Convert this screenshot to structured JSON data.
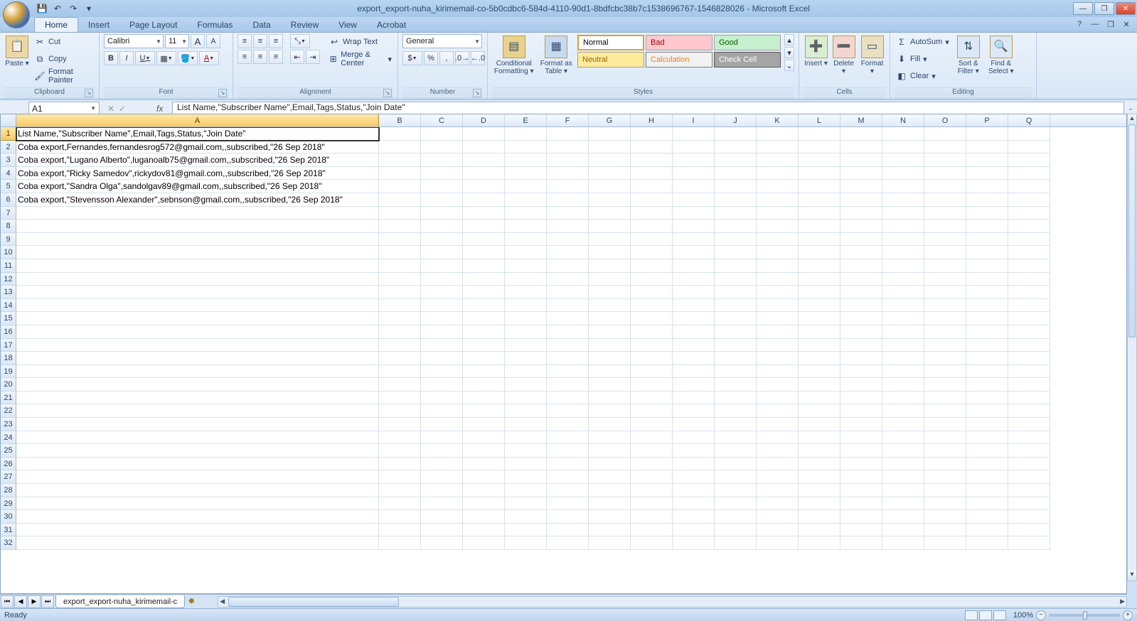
{
  "titlebar": {
    "title": "export_export-nuha_kirimemail-co-5b0cdbc6-584d-4110-90d1-8bdfcbc38b7c1538696767-1546828026 - Microsoft Excel",
    "qat": {
      "save": "💾",
      "undo": "↶",
      "redo": "↷",
      "more": "▾"
    },
    "win": {
      "min": "—",
      "max": "❐",
      "close": "✕"
    }
  },
  "tabs": {
    "items": [
      "Home",
      "Insert",
      "Page Layout",
      "Formulas",
      "Data",
      "Review",
      "View",
      "Acrobat"
    ],
    "active": "Home",
    "help": "?",
    "rmin": "—",
    "rmax": "❐",
    "rclose": "✕"
  },
  "ribbon": {
    "clipboard": {
      "label": "Clipboard",
      "paste": "Paste",
      "cut": "Cut",
      "copy": "Copy",
      "format_painter": "Format Painter"
    },
    "font": {
      "label": "Font",
      "name": "Calibri",
      "size": "11",
      "grow": "A",
      "shrink": "A",
      "bold": "B",
      "italic": "I",
      "underline": "U"
    },
    "alignment": {
      "label": "Alignment",
      "wrap": "Wrap Text",
      "merge": "Merge & Center"
    },
    "number": {
      "label": "Number",
      "format": "General"
    },
    "styles": {
      "label": "Styles",
      "cond": "Conditional Formatting",
      "table": "Format as Table",
      "normal": "Normal",
      "bad": "Bad",
      "good": "Good",
      "neutral": "Neutral",
      "calc": "Calculation",
      "check": "Check Cell"
    },
    "cells": {
      "label": "Cells",
      "insert": "Insert",
      "delete": "Delete",
      "format": "Format"
    },
    "editing": {
      "label": "Editing",
      "autosum": "AutoSum",
      "fill": "Fill",
      "clear": "Clear",
      "sort": "Sort & Filter",
      "find": "Find & Select"
    }
  },
  "formula_bar": {
    "name_box": "A1",
    "fx": "fx",
    "formula": "List Name,\"Subscriber Name\",Email,Tags,Status,\"Join Date\""
  },
  "grid": {
    "col_widths": {
      "A": 510,
      "other": 59
    },
    "columns": [
      "A",
      "B",
      "C",
      "D",
      "E",
      "F",
      "G",
      "H",
      "I",
      "J",
      "K",
      "L",
      "M",
      "N",
      "O",
      "P",
      "Q"
    ],
    "active_cell": "A1",
    "data": [
      "List Name,\"Subscriber Name\",Email,Tags,Status,\"Join Date\"",
      "Coba export,Fernandes,fernandesrog572@gmail.com,,subscribed,\"26 Sep 2018\"",
      "Coba export,\"Lugano Alberto\",luganoalb75@gmail.com,,subscribed,\"26 Sep 2018\"",
      "Coba export,\"Ricky Samedov\",rickydov81@gmail.com,,subscribed,\"26 Sep 2018\"",
      "Coba export,\"Sandra Olga\",sandolgav89@gmail.com,,subscribed,\"26 Sep 2018\"",
      "Coba export,\"Stevensson Alexander\",sebnson@gmail.com,,subscribed,\"26 Sep 2018\""
    ],
    "total_rows": 32
  },
  "sheetbar": {
    "nav": [
      "⏮",
      "◀",
      "▶",
      "⏭"
    ],
    "sheet": "export_export-nuha_kirimemail-c",
    "new": "✸"
  },
  "status": {
    "ready": "Ready",
    "zoom": "100%"
  }
}
